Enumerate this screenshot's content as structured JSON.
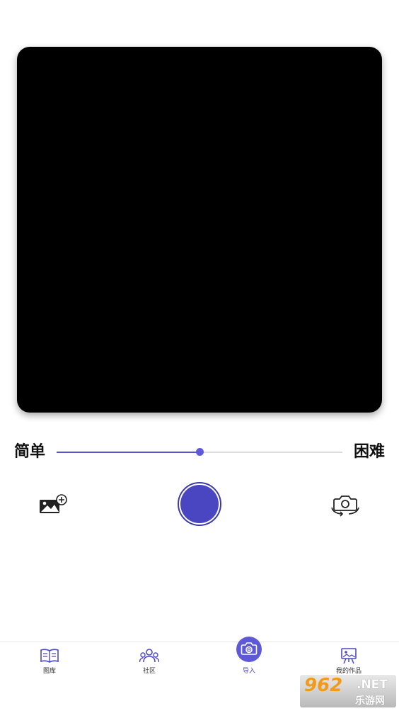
{
  "difficulty": {
    "easy_label": "简单",
    "hard_label": "困难",
    "level": 0.5
  },
  "camera": {
    "gallery_icon": "add-image-icon",
    "shutter_icon": "shutter-button",
    "switch_icon": "switch-camera-icon"
  },
  "tabs": [
    {
      "label": "图库",
      "icon": "open-book-icon",
      "active": false
    },
    {
      "label": "社区",
      "icon": "people-icon",
      "active": false
    },
    {
      "label": "导入",
      "icon": "camera-icon",
      "active": true
    },
    {
      "label": "我的作品",
      "icon": "easel-icon",
      "active": false
    }
  ],
  "watermark": {
    "brand": "962",
    "domain": ".NET",
    "sub": "乐游网"
  },
  "colors": {
    "accent": "#5e59d6",
    "shutter": "#4a45c0",
    "preview_bg": "#000000"
  }
}
